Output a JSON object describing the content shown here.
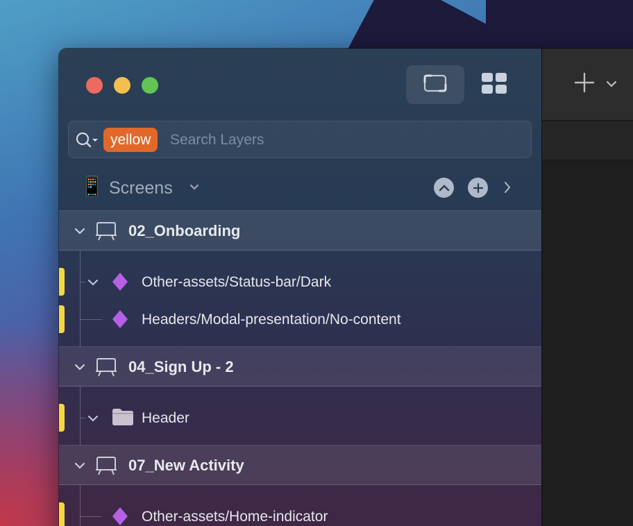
{
  "window": {
    "view_modes": [
      {
        "icon": "single-canvas-icon",
        "active": true
      },
      {
        "icon": "grid-view-icon",
        "active": false
      }
    ]
  },
  "search": {
    "token": "yellow",
    "placeholder": "Search Layers",
    "value": ""
  },
  "screens": {
    "label": "Screens",
    "icon": "phone-icon"
  },
  "layers": {
    "groups": [
      {
        "name": "02_Onboarding",
        "icon": "artboard-icon",
        "children": [
          {
            "label": "Other-assets/Status-bar/Dark",
            "icon": "symbol-icon",
            "tag_color": "#f5d93c",
            "expandable": true
          },
          {
            "label": "Headers/Modal-presentation/No-content",
            "icon": "symbol-icon",
            "tag_color": "#f5d93c",
            "expandable": false
          }
        ]
      },
      {
        "name": "04_Sign Up - 2",
        "icon": "artboard-icon",
        "children": [
          {
            "label": "Header",
            "icon": "folder-icon",
            "tag_color": "#f5d93c",
            "expandable": true
          }
        ]
      },
      {
        "name": "07_New Activity",
        "icon": "artboard-icon",
        "children": [
          {
            "label": "Other-assets/Home-indicator",
            "icon": "symbol-icon",
            "tag_color": "#f5d93c",
            "expandable": false
          }
        ]
      }
    ]
  },
  "toolbar": {
    "insert_icon": "plus-icon",
    "insert_menu_icon": "chevron-down-icon"
  },
  "colors": {
    "token_bg": "#e2682a",
    "tag_yellow": "#f5d93c",
    "symbol_purple": "#b660e6"
  }
}
